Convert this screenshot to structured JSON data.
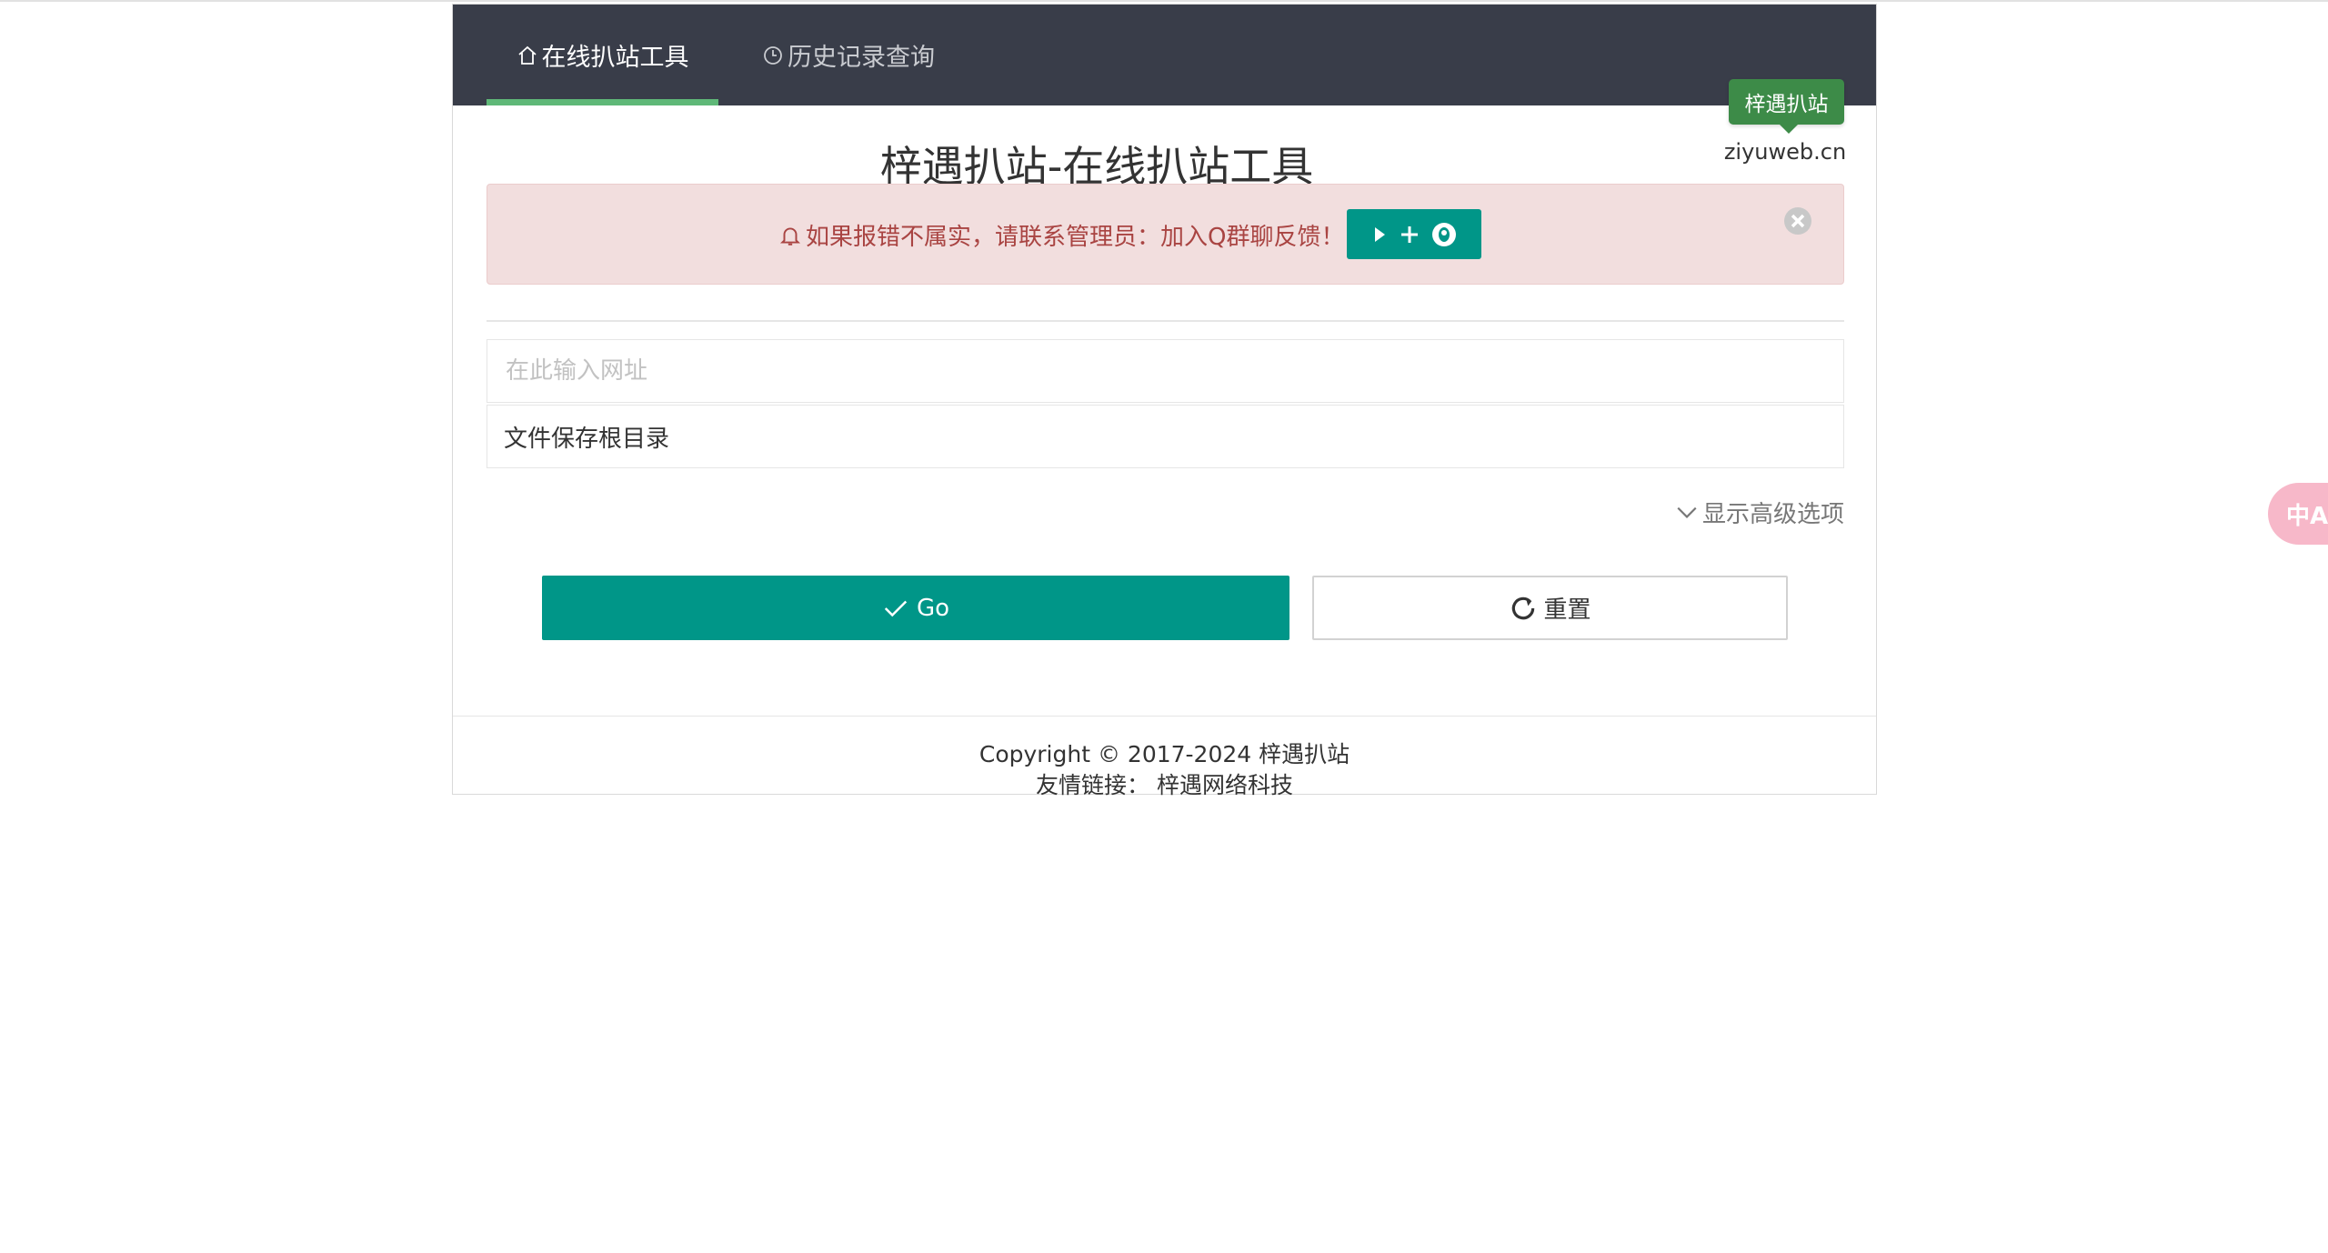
{
  "nav": {
    "tabs": [
      {
        "label": "在线扒站工具",
        "icon": "home-icon",
        "active": true
      },
      {
        "label": "历史记录查询",
        "icon": "clock-icon",
        "active": false
      }
    ],
    "active_color": "#5fb878",
    "background": "#393d49"
  },
  "brand": {
    "badge": "梓遇扒站",
    "domain": "ziyuweb.cn"
  },
  "title": "梓遇扒站-在线扒站工具",
  "alert": {
    "message": "如果报错不属实，请联系管理员：加入Q群聊反馈！",
    "icon": "bell-icon",
    "button_icons": [
      "play-icon",
      "plus-icon",
      "qq-icon"
    ],
    "close_icon": "close-circle-icon"
  },
  "form": {
    "url_placeholder": "在此输入网址",
    "url_value": "",
    "save_dir_value": "文件保存根目录",
    "advanced_toggle": "显示高级选项"
  },
  "buttons": {
    "go": "Go",
    "reset": "重置"
  },
  "footer": {
    "copyright": "Copyright © 2017-2024 梓遇扒站",
    "links_label": "友情链接：",
    "links": [
      "梓遇网络科技"
    ]
  },
  "translate_widget": {
    "label": "中A",
    "icon": "translate-icon"
  },
  "colors": {
    "primary": "#009688",
    "badge": "#3d8b48",
    "alert_bg": "#f2dede",
    "alert_text": "#a94442"
  }
}
